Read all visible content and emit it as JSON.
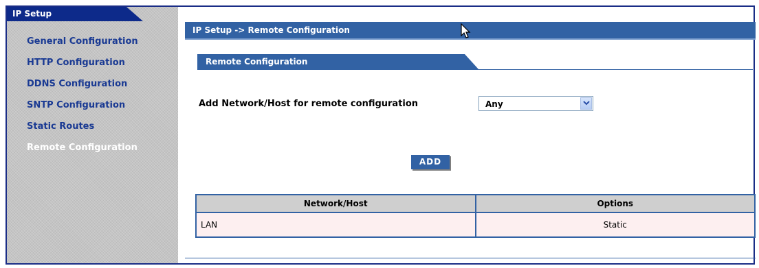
{
  "sidebar": {
    "header": "IP Setup",
    "items": [
      {
        "label": "General Configuration",
        "active": false
      },
      {
        "label": "HTTP Configuration",
        "active": false
      },
      {
        "label": "DDNS Configuration",
        "active": false
      },
      {
        "label": "SNTP Configuration",
        "active": false
      },
      {
        "label": "Static Routes",
        "active": false
      },
      {
        "label": "Remote Configuration",
        "active": true
      }
    ]
  },
  "main": {
    "breadcrumb": "IP Setup -> Remote Configuration",
    "section_title": "Remote Configuration",
    "form": {
      "label": "Add Network/Host for remote configuration",
      "select_value": "Any",
      "add_button": "ADD"
    },
    "table": {
      "headers": [
        "Network/Host",
        "Options"
      ],
      "rows": [
        {
          "network": "LAN",
          "options": "Static"
        }
      ]
    }
  },
  "colors": {
    "frame": "#1a2d86",
    "header_blue": "#3262a4",
    "sidebar_tab": "#0d2a8a",
    "sidebar_link": "#1a3a93",
    "sidebar_bg": "#c4c4c4",
    "row_bg": "#fdeff0",
    "table_header_bg": "#cfcfcf"
  },
  "icons": {
    "select_arrow": "chevron-down-icon",
    "cursor": "mouse-pointer-icon"
  }
}
